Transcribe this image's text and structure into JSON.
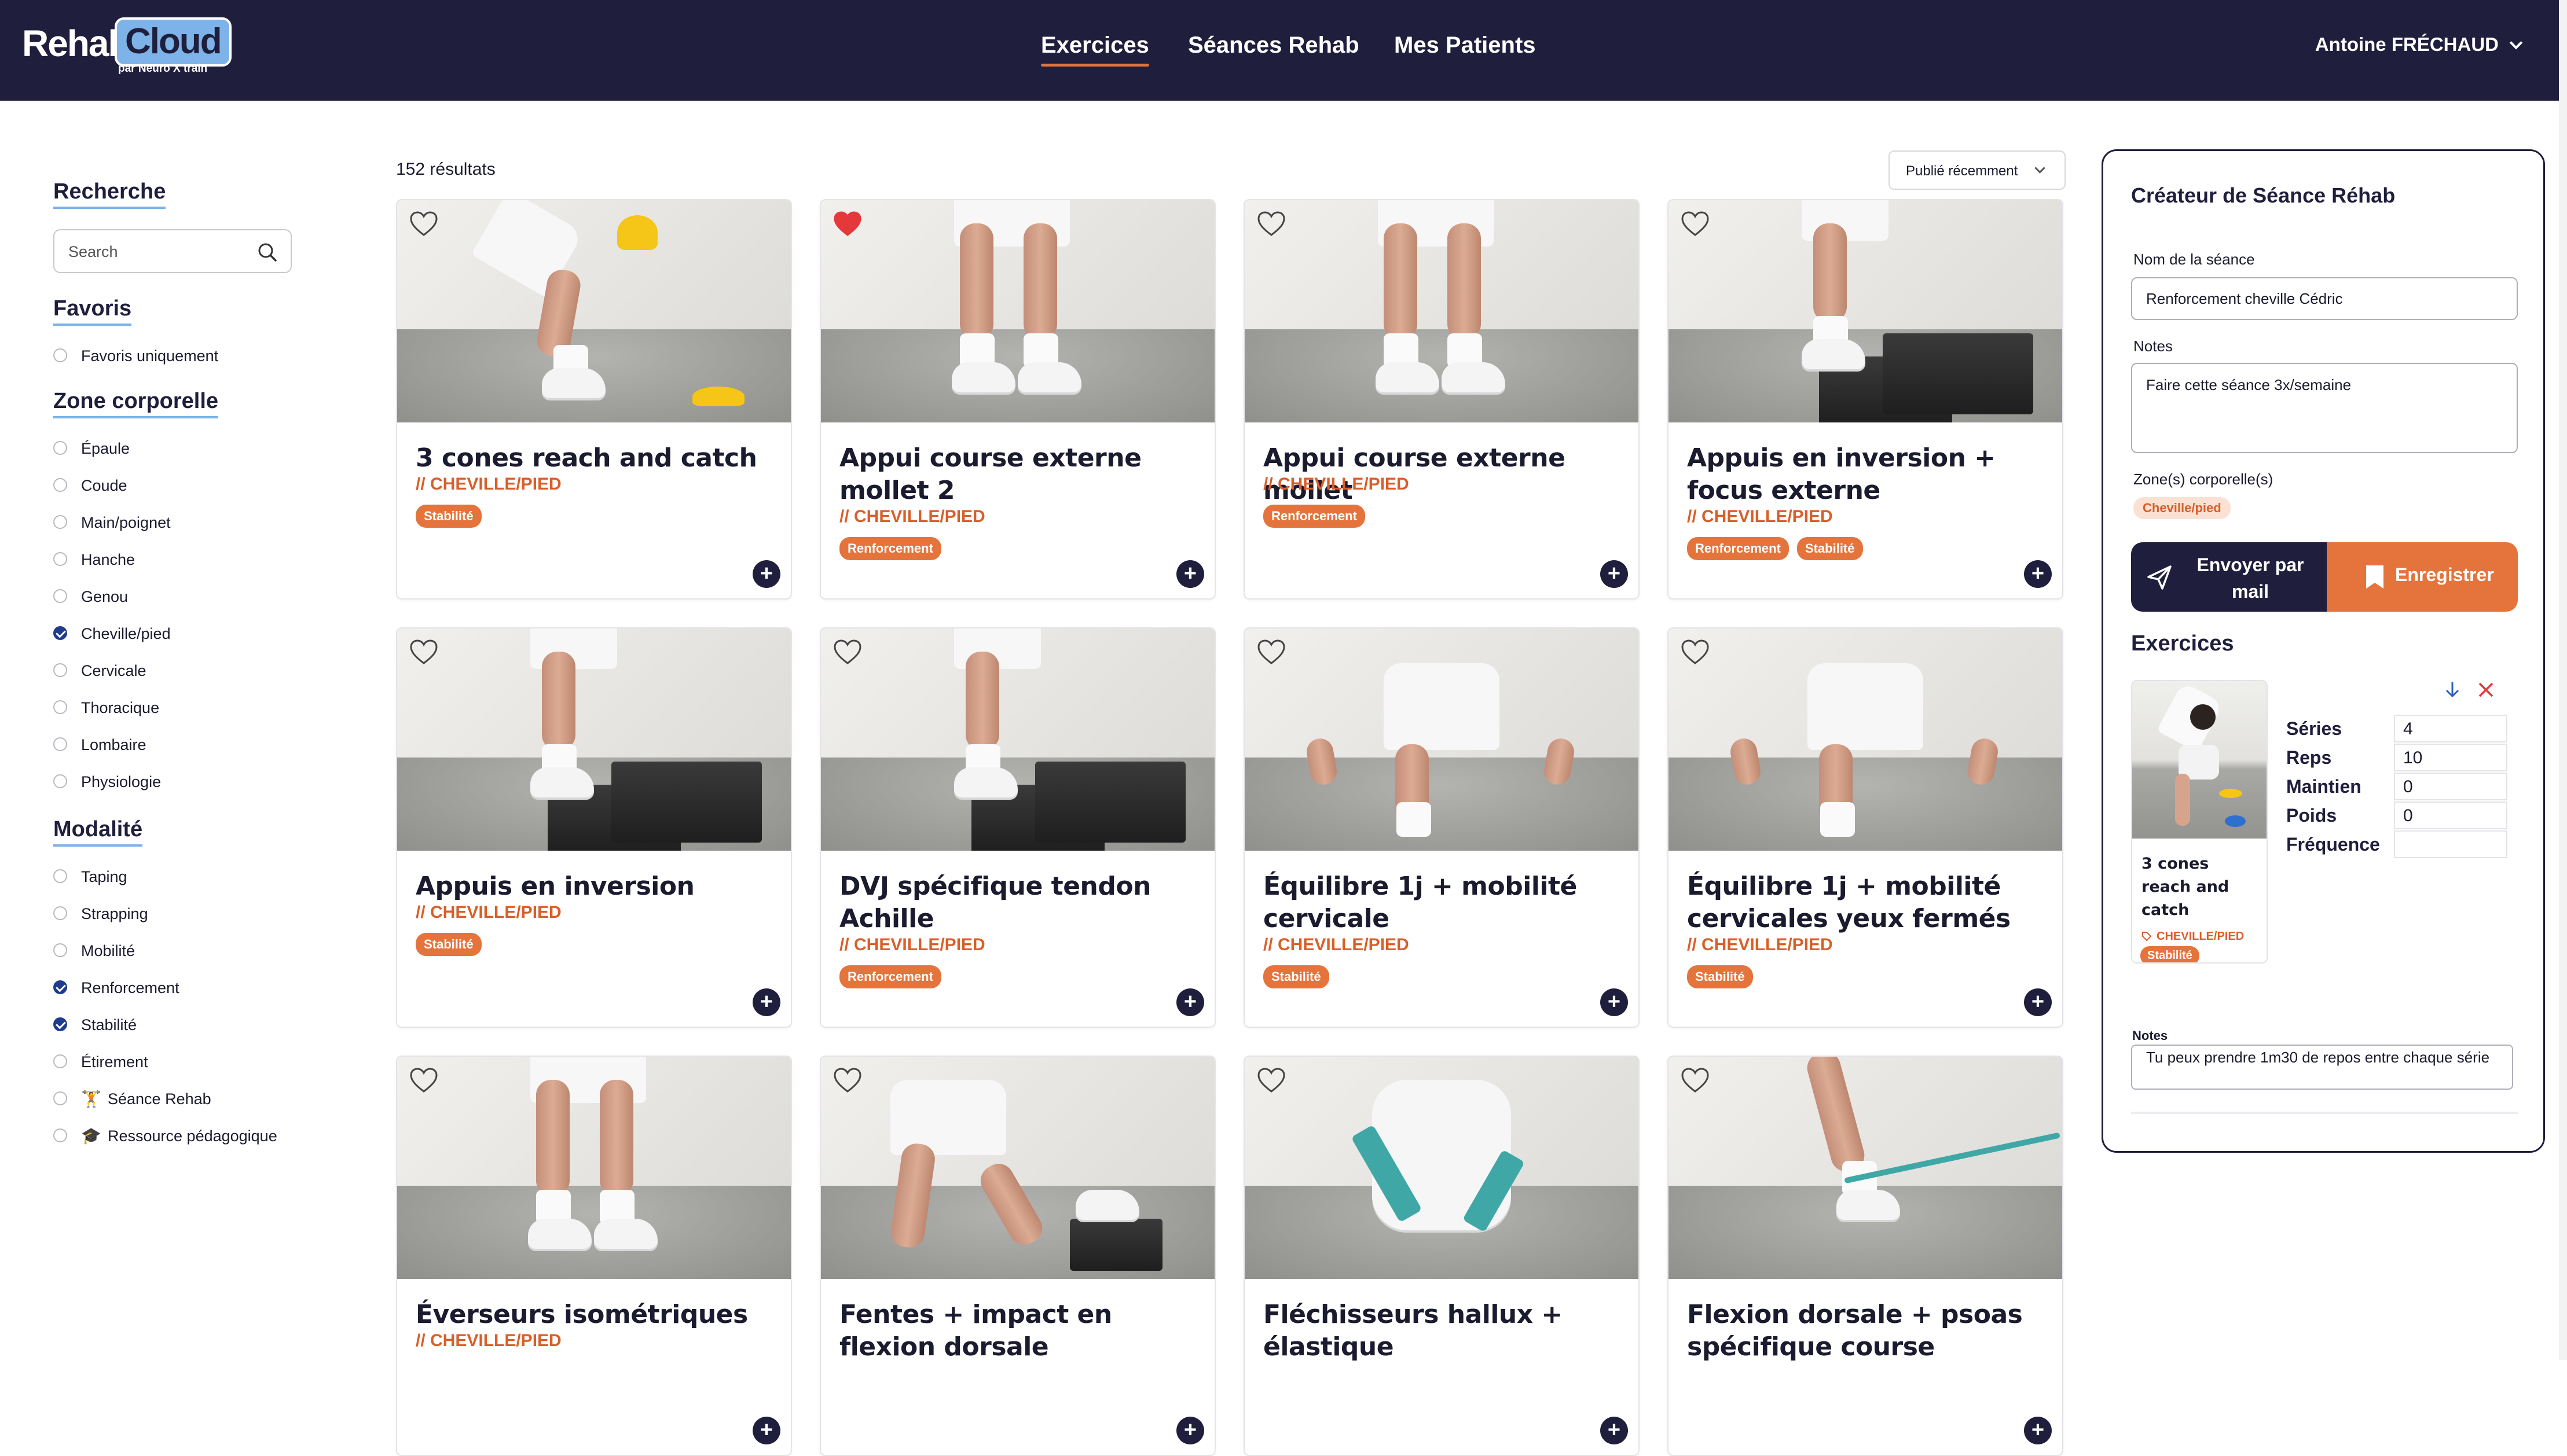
{
  "app": {
    "logo_main": "Rehab",
    "logo_accent": "Cloud",
    "logo_sub": "par Neuro X train"
  },
  "nav": {
    "links": [
      "Exercices",
      "Séances Rehab",
      "Mes Patients"
    ],
    "active_index": 0,
    "user_name": "Antoine FRÉCHAUD"
  },
  "colors": {
    "navy": "#1f1e3c",
    "orange": "#e4743c",
    "zone_text": "#d95f2a",
    "accent_blue": "#7db3e8",
    "favorite_red": "#e5383b"
  },
  "sidebar": {
    "search_heading": "Recherche",
    "search_placeholder": "Search",
    "favorites_heading": "Favoris",
    "favorites_options": [
      {
        "label": "Favoris uniquement",
        "checked": false
      }
    ],
    "zone_heading": "Zone corporelle",
    "zone_options": [
      {
        "label": "Épaule",
        "checked": false
      },
      {
        "label": "Coude",
        "checked": false
      },
      {
        "label": "Main/poignet",
        "checked": false
      },
      {
        "label": "Hanche",
        "checked": false
      },
      {
        "label": "Genou",
        "checked": false
      },
      {
        "label": "Cheville/pied",
        "checked": true
      },
      {
        "label": "Cervicale",
        "checked": false
      },
      {
        "label": "Thoracique",
        "checked": false
      },
      {
        "label": "Lombaire",
        "checked": false
      },
      {
        "label": "Physiologie",
        "checked": false
      }
    ],
    "modality_heading": "Modalité",
    "modality_options": [
      {
        "label": "Taping",
        "checked": false
      },
      {
        "label": "Strapping",
        "checked": false
      },
      {
        "label": "Mobilité",
        "checked": false
      },
      {
        "label": "Renforcement",
        "checked": true
      },
      {
        "label": "Stabilité",
        "checked": true
      },
      {
        "label": "Étirement",
        "checked": false
      },
      {
        "label": "Séance Rehab",
        "checked": false,
        "emoji": "🏋️"
      },
      {
        "label": "Ressource pédagogique",
        "checked": false,
        "emoji": "🎓"
      }
    ]
  },
  "results": {
    "count_label": "152 résultats",
    "sort_label": "Publié récemment"
  },
  "cards": [
    {
      "title": "3 cones reach and catch",
      "zone": "// CHEVILLE/PIED",
      "tags": [
        "Stabilité"
      ],
      "favorite": false,
      "photo": "cones"
    },
    {
      "title": "Appui course externe mollet 2",
      "zone": "// CHEVILLE/PIED",
      "tags": [
        "Renforcement"
      ],
      "favorite": true,
      "photo": "legs"
    },
    {
      "title": "Appui course externe mollet",
      "zone": "// CHEVILLE/PIED",
      "tags": [
        "Renforcement"
      ],
      "favorite": false,
      "photo": "legs"
    },
    {
      "title": "Appuis en inversion + focus externe",
      "zone": "// CHEVILLE/PIED",
      "tags": [
        "Renforcement",
        "Stabilité"
      ],
      "favorite": false,
      "photo": "box"
    },
    {
      "title": "Appuis en inversion",
      "zone": "// CHEVILLE/PIED",
      "tags": [
        "Stabilité"
      ],
      "favorite": false,
      "photo": "box"
    },
    {
      "title": "DVJ spécifique tendon Achille",
      "zone": "// CHEVILLE/PIED",
      "tags": [
        "Renforcement"
      ],
      "favorite": false,
      "photo": "box"
    },
    {
      "title": "Équilibre 1j + mobilité cervicale",
      "zone": "// CHEVILLE/PIED",
      "tags": [
        "Stabilité"
      ],
      "favorite": false,
      "photo": "balance"
    },
    {
      "title": "Équilibre 1j + mobilité cervicales yeux fermés",
      "zone": "// CHEVILLE/PIED",
      "tags": [
        "Stabilité"
      ],
      "favorite": false,
      "photo": "balance"
    },
    {
      "title": "Éverseurs isométriques",
      "zone": "// CHEVILLE/PIED",
      "tags": [],
      "favorite": false,
      "photo": "legs"
    },
    {
      "title": "Fentes + impact en flexion dorsale",
      "zone": "",
      "tags": [],
      "favorite": false,
      "photo": "lunge"
    },
    {
      "title": "Fléchisseurs hallux + élastique",
      "zone": "",
      "tags": [],
      "favorite": false,
      "photo": "band"
    },
    {
      "title": "Flexion dorsale + psoas spécifique course",
      "zone": "",
      "tags": [],
      "favorite": false,
      "photo": "bandleg"
    }
  ],
  "panel": {
    "title": "Créateur de Séance Réhab",
    "name_label": "Nom de la séance",
    "name_value": "Renforcement cheville Cédric",
    "notes_label": "Notes",
    "notes_value": "Faire cette séance 3x/semaine",
    "zones_label": "Zone(s) corporelle(s)",
    "zone_pill": "Cheville/pied",
    "send_label": "Envoyer par mail",
    "save_label": "Enregistrer",
    "exercises_heading": "Exercices",
    "exercise": {
      "name": "3 cones reach and catch",
      "zone": "CHEVILLE/PIED",
      "tag": "Stabilité",
      "stats": [
        {
          "label": "Séries",
          "value": "4"
        },
        {
          "label": "Reps",
          "value": "10"
        },
        {
          "label": "Maintien",
          "value": "0"
        },
        {
          "label": "Poids",
          "value": "0"
        },
        {
          "label": "Fréquence",
          "value": ""
        }
      ],
      "notes_label": "Notes",
      "notes_value": "Tu peux prendre 1m30 de repos entre chaque série"
    }
  }
}
